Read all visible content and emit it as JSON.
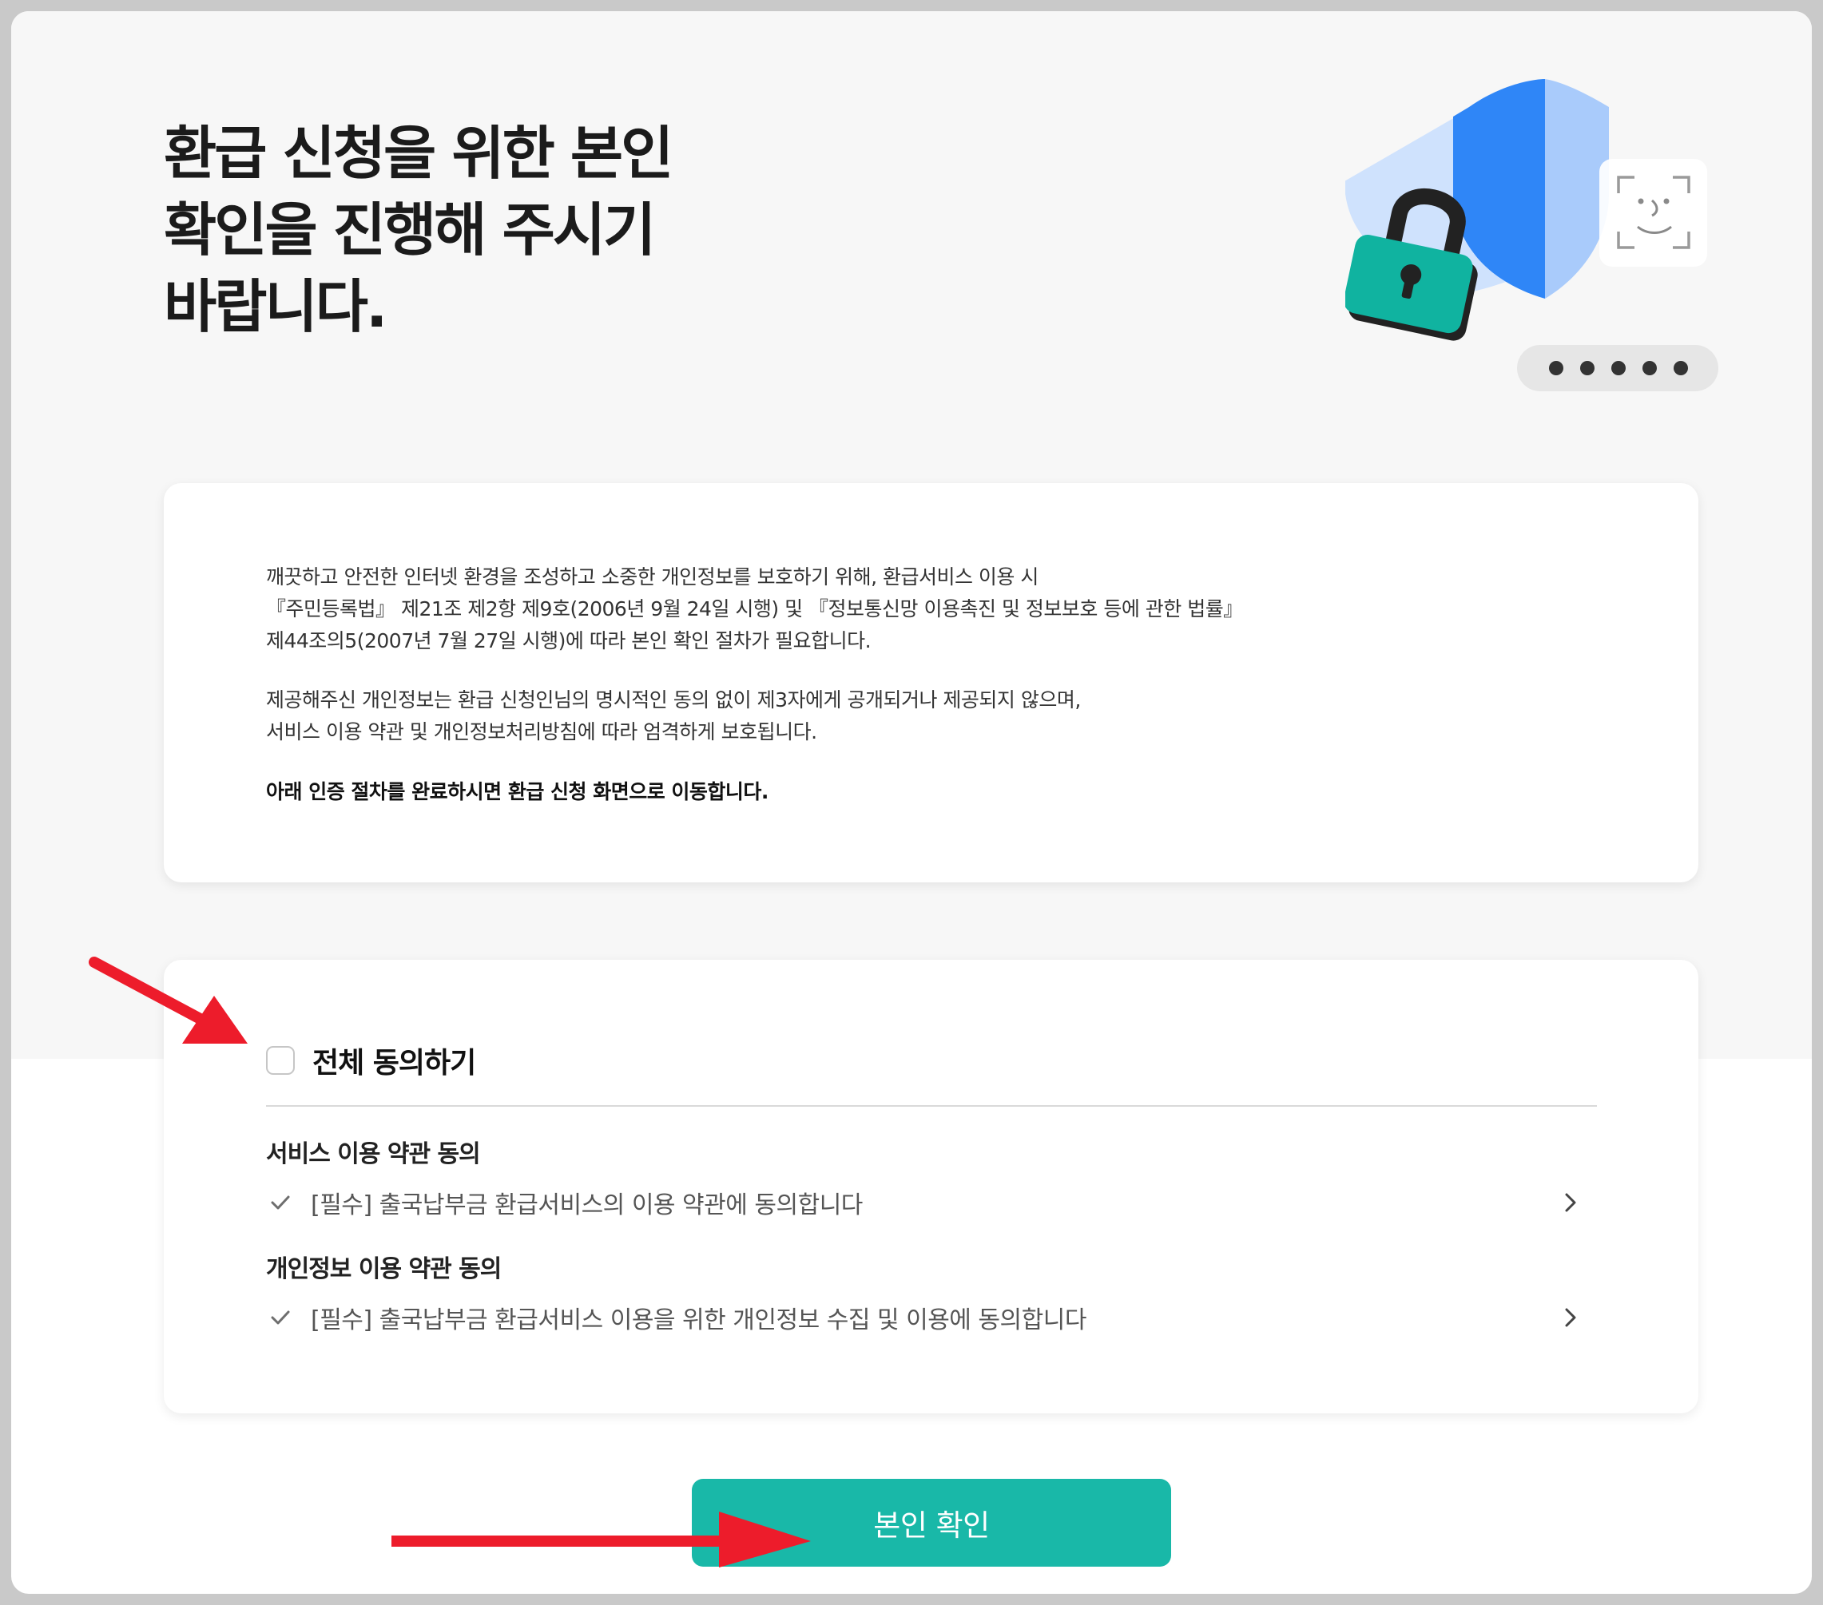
{
  "header": {
    "title_lines": [
      "환급 신청을 위한 본인",
      "확인을 진행해 주시기",
      "바랍니다."
    ]
  },
  "illustration": {
    "icons": [
      "shield-icon",
      "padlock-icon",
      "face-id-icon",
      "password-dots-icon"
    ]
  },
  "notice": {
    "para1_lines": [
      "깨끗하고 안전한 인터넷 환경을 조성하고 소중한 개인정보를 보호하기 위해, 환급서비스 이용 시",
      "『주민등록법』 제21조 제2항 제9호(2006년 9월 24일 시행) 및 『정보통신망 이용촉진 및 정보보호 등에 관한 법률』",
      "제44조의5(2007년 7월 27일 시행)에 따라 본인 확인 절차가 필요합니다."
    ],
    "para2_lines": [
      "제공해주신 개인정보는 환급 신청인님의 명시적인 동의 없이 제3자에게 공개되거나 제공되지 않으며,",
      "서비스 이용 약관 및 개인정보처리방침에 따라 엄격하게 보호됩니다."
    ],
    "para3": "아래 인증 절차를 완료하시면 환급 신청 화면으로 이동합니다."
  },
  "agreement": {
    "all_label": "전체 동의하기",
    "all_checked": false,
    "sections": [
      {
        "title": "서비스 이용 약관 동의",
        "item": "[필수] 출국납부금 환급서비스의 이용 약관에 동의합니다"
      },
      {
        "title": "개인정보 이용 약관 동의",
        "item": "[필수] 출국납부금 환급서비스 이용을 위한 개인정보 수집 및 이용에 동의합니다"
      }
    ]
  },
  "confirm_button": {
    "label": "본인 확인"
  },
  "colors": {
    "accent": "#19b8a8",
    "annotation_arrow": "#ed1c2b",
    "shield_blue": "#2f86f7",
    "lock_teal": "#10b3a0"
  }
}
